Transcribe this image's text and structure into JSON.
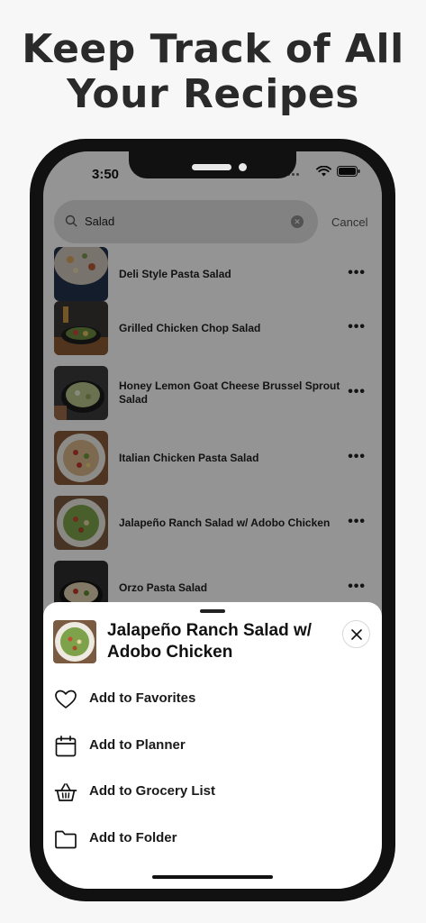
{
  "headline": {
    "line1": "Keep Track of All",
    "line2": "Your Recipes"
  },
  "status": {
    "time": "3:50"
  },
  "search": {
    "value": "Salad",
    "cancel_label": "Cancel"
  },
  "recipes": [
    {
      "title": "Deli Style Pasta Salad",
      "more": "•••"
    },
    {
      "title": "Grilled Chicken Chop Salad",
      "more": "•••"
    },
    {
      "title": "Honey Lemon Goat Cheese Brussel Sprout Salad",
      "more": "•••"
    },
    {
      "title": "Italian Chicken Pasta Salad",
      "more": "•••"
    },
    {
      "title": "Jalapeño Ranch Salad w/ Adobo Chicken",
      "more": "•••"
    },
    {
      "title": "Orzo Pasta Salad",
      "more": "•••"
    }
  ],
  "sheet": {
    "title": "Jalapeño Ranch Salad w/ Adobo Chicken",
    "actions": [
      {
        "label": "Add to Favorites",
        "icon": "heart-icon"
      },
      {
        "label": "Add to Planner",
        "icon": "calendar-icon"
      },
      {
        "label": "Add to Grocery List",
        "icon": "basket-icon"
      },
      {
        "label": "Add to Folder",
        "icon": "folder-icon"
      }
    ]
  },
  "colors": {
    "background": "#f7f7f7",
    "text": "#2a2a2a",
    "overlay": "rgba(0,0,0,0.42)"
  }
}
